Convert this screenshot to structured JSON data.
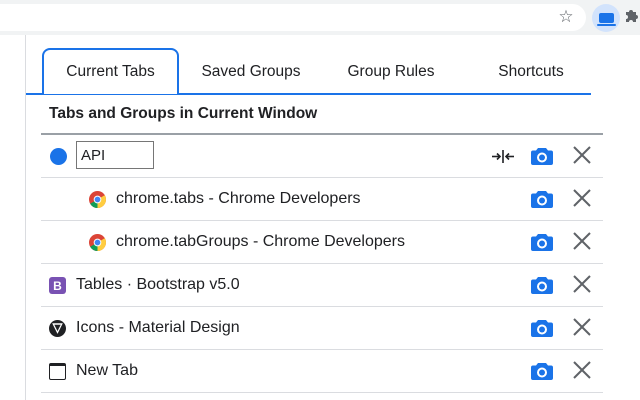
{
  "browser": {
    "star_icon": "star-icon",
    "extension_icon": "keyboard-extension-icon",
    "puzzle_icon": "puzzle-icon"
  },
  "colors": {
    "accent": "#1a73e8",
    "bootstrap": "#7952b3"
  },
  "tabs": [
    {
      "label": "Current Tabs",
      "active": true
    },
    {
      "label": "Saved Groups",
      "active": false
    },
    {
      "label": "Group Rules",
      "active": false
    },
    {
      "label": "Shortcuts",
      "active": false
    }
  ],
  "heading": "Tabs and Groups in Current Window",
  "group": {
    "name": "API",
    "color": "#1a73e8"
  },
  "items": [
    {
      "title": "chrome.tabs - Chrome Developers",
      "icon": "chrome-icon",
      "indented": true
    },
    {
      "title": "chrome.tabGroups - Chrome Developers",
      "icon": "chrome-icon",
      "indented": true
    },
    {
      "title": "Tables · Bootstrap v5.0",
      "icon": "bootstrap-icon",
      "icon_text": "B",
      "indented": false
    },
    {
      "title": "Icons - Material Design",
      "icon": "material-design-icon",
      "indented": false
    },
    {
      "title": "New Tab",
      "icon": "new-tab-icon",
      "indented": false
    }
  ]
}
